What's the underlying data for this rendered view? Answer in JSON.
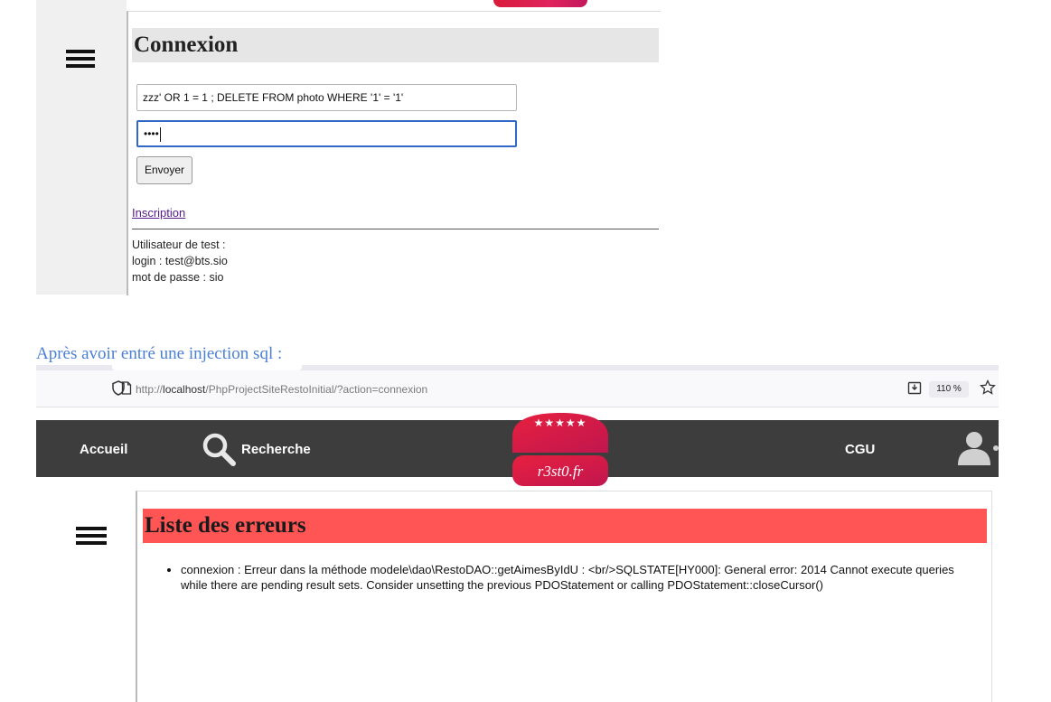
{
  "login_screen": {
    "title": "Connexion",
    "login_value": "zzz' OR 1 = 1 ; DELETE FROM photo WHERE '1' = '1'",
    "password_value": "••••",
    "submit_label": "Envoyer",
    "signup_link": "Inscription",
    "test_user": {
      "heading": "Utilisateur de test :",
      "login_line": "login : test@bts.sio",
      "password_line": "mot de passe : sio"
    }
  },
  "caption": "Après avoir entré une injection sql :",
  "browser": {
    "url_prefix": "http://",
    "url_host": "localhost",
    "url_path": "/PhpProjectSiteRestoInitial/?action=connexion",
    "zoom": "110 %"
  },
  "navbar": {
    "home": "Accueil",
    "search": "Recherche",
    "cgu": "CGU",
    "logo_text": "r3st0.fr",
    "logo_stars": "★★★★★"
  },
  "errors_page": {
    "title": "Liste des erreurs",
    "errors": [
      "connexion : Erreur dans la méthode modele\\dao\\RestoDAO::getAimesByIdU : <br/>SQLSTATE[HY000]: General error: 2014 Cannot execute queries while there are pending result sets. Consider unsetting the previous PDOStatement or calling PDOStatement::closeCursor()"
    ]
  },
  "colors": {
    "error_header": "#ff5555",
    "navbar": "#3d3d3d",
    "caption": "#4a7fd6",
    "logo_red": "#e0245e"
  }
}
